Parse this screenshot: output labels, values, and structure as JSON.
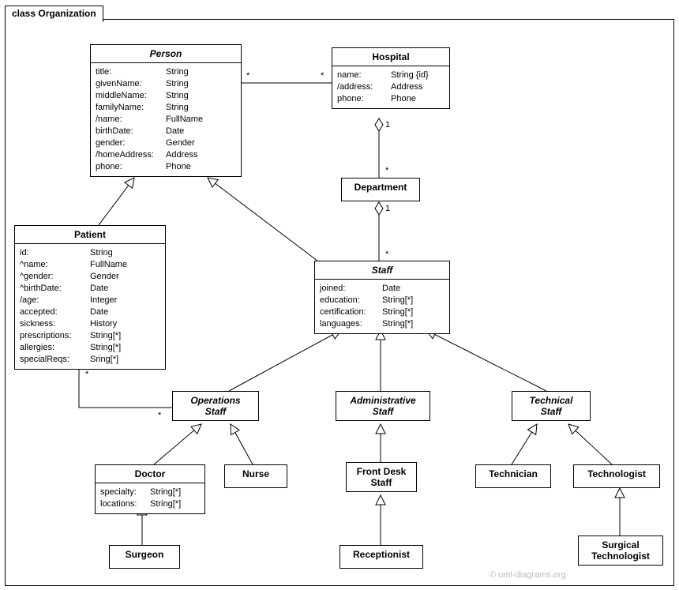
{
  "package": {
    "name": "class Organization"
  },
  "classes": {
    "person": {
      "name": "Person",
      "attrs": [
        [
          "title:",
          "String"
        ],
        [
          "givenName:",
          "String"
        ],
        [
          "middleName:",
          "String"
        ],
        [
          "familyName:",
          "String"
        ],
        [
          "/name:",
          "FullName"
        ],
        [
          "birthDate:",
          "Date"
        ],
        [
          "gender:",
          "Gender"
        ],
        [
          "/homeAddress:",
          "Address"
        ],
        [
          "phone:",
          "Phone"
        ]
      ]
    },
    "hospital": {
      "name": "Hospital",
      "attrs": [
        [
          "name:",
          "String {id}"
        ],
        [
          "/address:",
          "Address"
        ],
        [
          "phone:",
          "Phone"
        ]
      ]
    },
    "department": {
      "name": "Department"
    },
    "patient": {
      "name": "Patient",
      "attrs": [
        [
          "id:",
          "String"
        ],
        [
          "^name:",
          "FullName"
        ],
        [
          "^gender:",
          "Gender"
        ],
        [
          "^birthDate:",
          "Date"
        ],
        [
          "/age:",
          "Integer"
        ],
        [
          "accepted:",
          "Date"
        ],
        [
          "sickness:",
          "History"
        ],
        [
          "prescriptions:",
          "String[*]"
        ],
        [
          "allergies:",
          "String[*]"
        ],
        [
          "specialReqs:",
          "Sring[*]"
        ]
      ]
    },
    "staff": {
      "name": "Staff",
      "attrs": [
        [
          "joined:",
          "Date"
        ],
        [
          "education:",
          "String[*]"
        ],
        [
          "certification:",
          "String[*]"
        ],
        [
          "languages:",
          "String[*]"
        ]
      ]
    },
    "opstaff": {
      "name": "OperationsStaff",
      "twoLine": [
        "Operations",
        "Staff"
      ]
    },
    "adminstaff": {
      "name": "AdministrativeStaff",
      "twoLine": [
        "Administrative",
        "Staff"
      ]
    },
    "techstaff": {
      "name": "TechnicalStaff",
      "twoLine": [
        "Technical",
        "Staff"
      ]
    },
    "doctor": {
      "name": "Doctor",
      "attrs": [
        [
          "specialty:",
          "String[*]"
        ],
        [
          "locations:",
          "String[*]"
        ]
      ]
    },
    "nurse": {
      "name": "Nurse"
    },
    "frontdesk": {
      "name": "FrontDeskStaff",
      "twoLine": [
        "Front Desk",
        "Staff"
      ]
    },
    "receptionist": {
      "name": "Receptionist"
    },
    "technician": {
      "name": "Technician"
    },
    "technologist": {
      "name": "Technologist"
    },
    "surgtech": {
      "name": "SurgicalTechnologist",
      "twoLine": [
        "Surgical",
        "Technologist"
      ]
    },
    "surgeon": {
      "name": "Surgeon"
    }
  },
  "multiplicities": {
    "person_hosp_l": "*",
    "person_hosp_r": "*",
    "hosp_dept_t": "1",
    "hosp_dept_b": "*",
    "dept_staff_t": "1",
    "dept_staff_b": "*",
    "patient_ops_l": "*",
    "patient_ops_r": "*"
  },
  "watermark": "© uml-diagrams.org"
}
